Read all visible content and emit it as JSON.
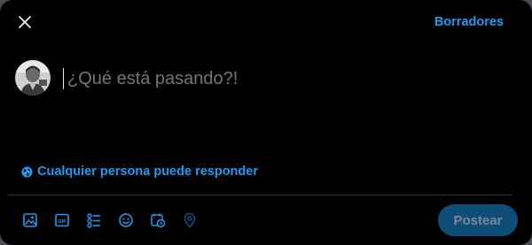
{
  "header": {
    "close_icon": "close-icon",
    "drafts_label": "Borradores"
  },
  "composer": {
    "avatar": "user-avatar",
    "placeholder": "¿Qué está pasando?!"
  },
  "reply_setting": {
    "icon": "globe-icon",
    "label": "Cualquier persona puede responder"
  },
  "toolbar": {
    "items": [
      "image-icon",
      "gif-icon",
      "poll-icon",
      "emoji-icon",
      "schedule-icon",
      "location-icon"
    ]
  },
  "post_button": {
    "label": "Postear"
  },
  "colors": {
    "accent": "#1d9bf0",
    "background": "#000000",
    "post_button_disabled": "#0f4e78"
  }
}
